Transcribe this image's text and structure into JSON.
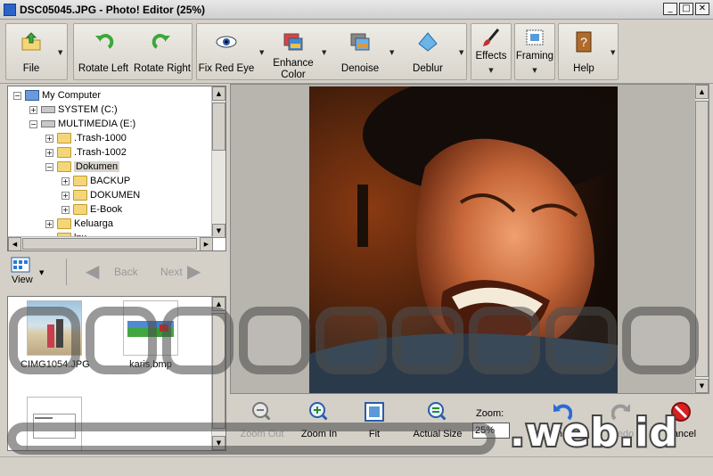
{
  "window": {
    "title": "DSC05045.JPG - Photo! Editor (25%)",
    "min": "_",
    "max": "□",
    "close": "✕"
  },
  "toolbar": {
    "file": "File",
    "rotate_left": "Rotate Left",
    "rotate_right": "Rotate Right",
    "fix_red_eye": "Fix Red Eye",
    "enhance_color": "Enhance Color",
    "denoise": "Denoise",
    "deblur": "Deblur",
    "effects": "Effects",
    "framing": "Framing",
    "help": "Help"
  },
  "tree": {
    "items": [
      {
        "label": "My Computer",
        "level": 0,
        "icon": "computer-icon",
        "expand": "−"
      },
      {
        "label": "SYSTEM (C:)",
        "level": 1,
        "icon": "drive-icon",
        "expand": "+"
      },
      {
        "label": "MULTIMEDIA (E:)",
        "level": 1,
        "icon": "drive-icon",
        "expand": "−"
      },
      {
        "label": ".Trash-1000",
        "level": 2,
        "icon": "folder-icon",
        "expand": "+"
      },
      {
        "label": ".Trash-1002",
        "level": 2,
        "icon": "folder-icon",
        "expand": "+"
      },
      {
        "label": "Dokumen",
        "level": 2,
        "icon": "folder-open-icon",
        "expand": "−",
        "selected": true
      },
      {
        "label": "BACKUP",
        "level": 3,
        "icon": "folder-icon",
        "expand": "+"
      },
      {
        "label": "DOKUMEN",
        "level": 3,
        "icon": "folder-icon",
        "expand": "+"
      },
      {
        "label": "E-Book",
        "level": 3,
        "icon": "folder-icon",
        "expand": "+"
      },
      {
        "label": "Keluarga",
        "level": 2,
        "icon": "people-folder-icon",
        "expand": "+"
      },
      {
        "label": "lnx",
        "level": 2,
        "icon": "folder-icon",
        "expand": ""
      }
    ]
  },
  "nav": {
    "view": "View",
    "back": "Back",
    "next": "Next"
  },
  "thumbs": [
    {
      "name": "CIMG1054.JPG"
    },
    {
      "name": "karis.bmp"
    },
    {
      "name": ""
    }
  ],
  "zoom": {
    "zoom_out": "Zoom Out",
    "zoom_in": "Zoom In",
    "fit": "Fit",
    "actual_size": "Actual Size",
    "zoom_label": "Zoom:",
    "zoom_value": "25%",
    "undo": "Undo",
    "redo": "Redo",
    "cancel": "Cancel"
  },
  "watermark": {
    "text": ".web.id"
  },
  "colors": {
    "accent": "#2b64c8",
    "folder": "#f4d67a",
    "selected": "#d8d4cc"
  }
}
